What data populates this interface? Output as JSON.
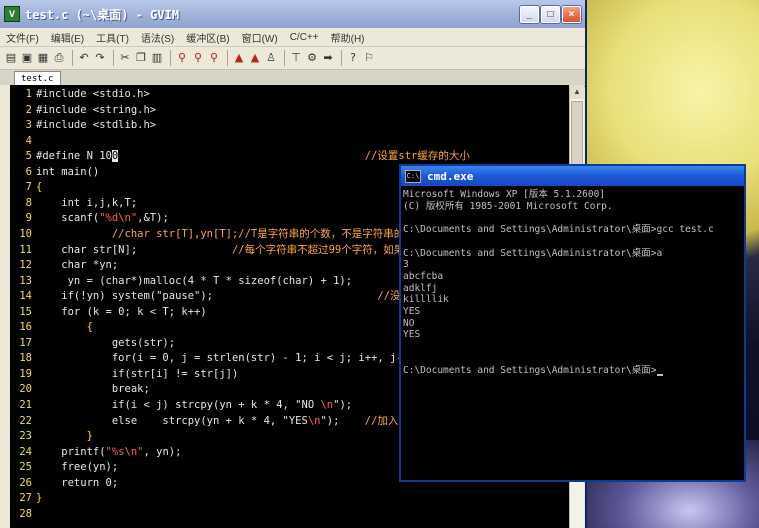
{
  "gvim": {
    "title": "test.c (~\\桌面) - GVIM",
    "menu": [
      "文件(F)",
      "编辑(E)",
      "工具(T)",
      "语法(S)",
      "缓冲区(B)",
      "窗口(W)",
      "C/C++",
      "帮助(H)"
    ],
    "tab_label": "test.c",
    "toolbar_icons": [
      "open-icon",
      "save-icon",
      "save-all-icon",
      "print-icon",
      "undo-icon",
      "redo-icon",
      "cut-icon",
      "copy-icon",
      "paste-icon",
      "find-replace-icon",
      "find-next-icon",
      "find-prev-icon",
      "load-session-icon",
      "save-session-icon",
      "run-script-icon",
      "make-icon",
      "run-ctags-icon",
      "jump-tag-icon",
      "help-icon",
      "find-help-icon"
    ],
    "code": [
      {
        "n": "1",
        "segs": [
          [
            "pp",
            "#include <stdio.h>"
          ]
        ]
      },
      {
        "n": "2",
        "segs": [
          [
            "pp",
            "#include <string.h>"
          ]
        ]
      },
      {
        "n": "3",
        "segs": [
          [
            "pp",
            "#include <stdlib.h>"
          ]
        ]
      },
      {
        "n": "4",
        "segs": []
      },
      {
        "n": "5",
        "segs": [
          [
            "pp",
            "#define N 10"
          ],
          [
            "cursor",
            "0"
          ],
          [
            "pp",
            "                                       "
          ],
          [
            "cmt",
            "//设置str缓存的大小"
          ]
        ]
      },
      {
        "n": "6",
        "segs": [
          [
            "kw",
            "int main()"
          ]
        ]
      },
      {
        "n": "7",
        "segs": [
          [
            "brace",
            "{"
          ]
        ]
      },
      {
        "n": "8",
        "segs": [
          [
            "kw",
            "    int i,j,k,T;"
          ]
        ]
      },
      {
        "n": "9",
        "segs": [
          [
            "kw",
            "    scanf("
          ],
          [
            "str",
            "\"%d\\n\""
          ],
          [
            "kw",
            ",&T);"
          ]
        ]
      },
      {
        "n": "10",
        "segs": [
          [
            "cmt",
            "            //char str[T],yn[T];//T是字符串的个数，不是字符串的长度"
          ]
        ]
      },
      {
        "n": "11",
        "segs": [
          [
            "kw",
            "    char str[N];               "
          ],
          [
            "cmt",
            "//每个字符串不超过99个字符，如果超了"
          ]
        ]
      },
      {
        "n": "12",
        "segs": [
          [
            "kw",
            "    char *yn;"
          ]
        ]
      },
      {
        "n": "13",
        "segs": [
          [
            "kw",
            "     yn = (char*)malloc(4 * T * sizeof(char) + 1);           "
          ],
          [
            "cmt",
            "//"
          ]
        ]
      },
      {
        "n": "14",
        "segs": [
          [
            "kw",
            "    if(!yn) system(\"pause\");                          "
          ],
          [
            "cmt",
            "//没有"
          ]
        ]
      },
      {
        "n": "15",
        "segs": [
          [
            "kw",
            "    for (k = 0; k < T; k++)"
          ]
        ]
      },
      {
        "n": "16",
        "segs": [
          [
            "brace",
            "        {"
          ]
        ]
      },
      {
        "n": "17",
        "segs": [
          [
            "kw",
            "            gets(str);"
          ]
        ]
      },
      {
        "n": "18",
        "segs": [
          [
            "kw",
            "            for(i = 0, j = strlen(str) - 1; i < j; i++, j--)"
          ]
        ]
      },
      {
        "n": "19",
        "segs": [
          [
            "kw",
            "            if(str[i] != str[j])"
          ]
        ]
      },
      {
        "n": "20",
        "segs": [
          [
            "kw",
            "            break;"
          ]
        ]
      },
      {
        "n": "21",
        "segs": [
          [
            "kw",
            "            if(i < j) strcpy(yn + k * 4, \"NO "
          ],
          [
            "str",
            "\\n"
          ],
          [
            "kw",
            "\");           "
          ],
          [
            "cmt",
            "//"
          ]
        ]
      },
      {
        "n": "22",
        "segs": [
          [
            "kw",
            "            else    strcpy(yn + k * 4, \"YES"
          ],
          [
            "str",
            "\\n"
          ],
          [
            "kw",
            "\");    "
          ],
          [
            "cmt",
            "//加入换行"
          ]
        ]
      },
      {
        "n": "23",
        "segs": [
          [
            "brace",
            "        }"
          ]
        ]
      },
      {
        "n": "24",
        "segs": [
          [
            "kw",
            "    printf("
          ],
          [
            "str",
            "\"%s\\n\""
          ],
          [
            "kw",
            ", yn);"
          ]
        ]
      },
      {
        "n": "25",
        "segs": [
          [
            "kw",
            "    free(yn);"
          ]
        ]
      },
      {
        "n": "26",
        "segs": [
          [
            "kw",
            "    return 0;"
          ]
        ]
      },
      {
        "n": "27",
        "segs": [
          [
            "brace",
            "}"
          ]
        ]
      },
      {
        "n": "28",
        "segs": []
      }
    ]
  },
  "cmd": {
    "title": "cmd.exe",
    "lines": [
      "Microsoft Windows XP [版本 5.1.2600]",
      "(C) 版权所有 1985-2001 Microsoft Corp.",
      "",
      "C:\\Documents and Settings\\Administrator\\桌面>gcc test.c",
      "",
      "C:\\Documents and Settings\\Administrator\\桌面>a",
      "3",
      "abcfcba",
      "adklfj",
      "killllik",
      "YES",
      "NO",
      "YES",
      "",
      "",
      "C:\\Documents and Settings\\Administrator\\桌面>"
    ]
  }
}
